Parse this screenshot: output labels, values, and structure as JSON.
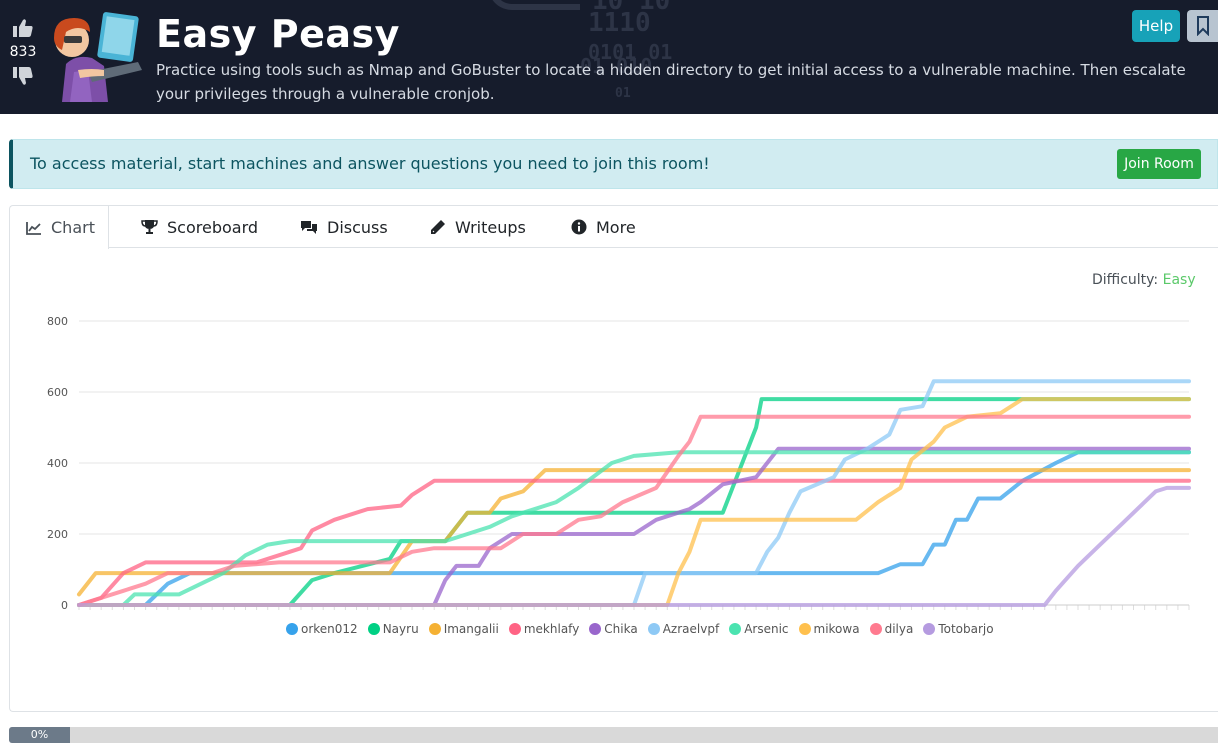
{
  "header": {
    "title": "Easy Peasy",
    "description": "Practice using tools such as Nmap and GoBuster to locate a hidden directory to get initial access to a vulnerable machine. Then escalate your privileges through a vulnerable cronjob.",
    "votes": "833",
    "help_label": "Help",
    "binary_text": [
      "10 10",
      "1110",
      "0101 01",
      "01 010",
      "01"
    ]
  },
  "alert": {
    "text": "To access material, start machines and answer questions you need to join this room!",
    "join_label": "Join Room"
  },
  "tabs": [
    {
      "label": "Chart",
      "icon": "line-chart-icon"
    },
    {
      "label": "Scoreboard",
      "icon": "trophy-icon"
    },
    {
      "label": "Discuss",
      "icon": "comments-icon"
    },
    {
      "label": "Writeups",
      "icon": "pencil-icon"
    },
    {
      "label": "More",
      "icon": "info-circle-icon"
    }
  ],
  "difficulty": {
    "label": "Difficulty:",
    "value": "Easy",
    "color": "#5bc96a"
  },
  "progress": {
    "value": 0,
    "label": "0%"
  },
  "chart_data": {
    "type": "line",
    "yticks": [
      0,
      200,
      400,
      600,
      800
    ],
    "ylim": [
      0,
      800
    ],
    "xlim": [
      0,
      100
    ],
    "grid": true,
    "legend_position": "bottom",
    "series": [
      {
        "name": "orken012",
        "color": "#36a2eb",
        "points": [
          [
            0,
            0
          ],
          [
            6,
            0
          ],
          [
            8,
            60
          ],
          [
            10,
            90
          ],
          [
            72,
            90
          ],
          [
            74,
            115
          ],
          [
            76,
            115
          ],
          [
            77,
            170
          ],
          [
            78,
            170
          ],
          [
            79,
            240
          ],
          [
            80,
            240
          ],
          [
            81,
            300
          ],
          [
            83,
            300
          ],
          [
            85,
            350
          ],
          [
            88,
            400
          ],
          [
            90,
            430
          ],
          [
            100,
            430
          ]
        ]
      },
      {
        "name": "Nayru",
        "color": "#00d084",
        "points": [
          [
            0,
            0
          ],
          [
            19,
            0
          ],
          [
            21,
            70
          ],
          [
            23,
            90
          ],
          [
            28,
            130
          ],
          [
            29,
            180
          ],
          [
            33,
            180
          ],
          [
            35,
            260
          ],
          [
            58,
            260
          ],
          [
            59,
            340
          ],
          [
            60,
            420
          ],
          [
            61,
            500
          ],
          [
            61.5,
            580
          ],
          [
            100,
            580
          ]
        ]
      },
      {
        "name": "Imangalii",
        "color": "#f5b133",
        "points": [
          [
            0,
            30
          ],
          [
            1.5,
            90
          ],
          [
            6,
            90
          ],
          [
            8,
            90
          ],
          [
            28,
            90
          ],
          [
            30,
            180
          ],
          [
            33,
            180
          ],
          [
            35,
            260
          ],
          [
            37,
            260
          ],
          [
            38,
            300
          ],
          [
            40,
            320
          ],
          [
            42,
            380
          ],
          [
            54,
            380
          ],
          [
            100,
            380
          ]
        ]
      },
      {
        "name": "mekhlafy",
        "color": "#ff6384",
        "points": [
          [
            0,
            0
          ],
          [
            2,
            20
          ],
          [
            4,
            90
          ],
          [
            6,
            120
          ],
          [
            16,
            120
          ],
          [
            18,
            140
          ],
          [
            20,
            160
          ],
          [
            21,
            210
          ],
          [
            23,
            240
          ],
          [
            26,
            270
          ],
          [
            29,
            280
          ],
          [
            30,
            310
          ],
          [
            32,
            350
          ],
          [
            100,
            350
          ]
        ]
      },
      {
        "name": "Chika",
        "color": "#9966cc",
        "points": [
          [
            0,
            0
          ],
          [
            32,
            0
          ],
          [
            33,
            70
          ],
          [
            34,
            110
          ],
          [
            36,
            110
          ],
          [
            37,
            160
          ],
          [
            39,
            200
          ],
          [
            50,
            200
          ],
          [
            52,
            240
          ],
          [
            55,
            270
          ],
          [
            56,
            290
          ],
          [
            58,
            340
          ],
          [
            61,
            360
          ],
          [
            63,
            440
          ],
          [
            68,
            440
          ],
          [
            100,
            440
          ]
        ]
      },
      {
        "name": "Azraelvpf",
        "color": "#8ec9f5",
        "points": [
          [
            0,
            0
          ],
          [
            50,
            0
          ],
          [
            51,
            90
          ],
          [
            61,
            90
          ],
          [
            62,
            150
          ],
          [
            63,
            190
          ],
          [
            64,
            260
          ],
          [
            65,
            320
          ],
          [
            68,
            360
          ],
          [
            69,
            410
          ],
          [
            71,
            440
          ],
          [
            73,
            480
          ],
          [
            74,
            550
          ],
          [
            76,
            560
          ],
          [
            77,
            630
          ],
          [
            100,
            630
          ]
        ]
      },
      {
        "name": "Arsenic",
        "color": "#4be3b0",
        "points": [
          [
            0,
            0
          ],
          [
            4,
            0
          ],
          [
            5,
            30
          ],
          [
            9,
            30
          ],
          [
            11,
            60
          ],
          [
            13,
            90
          ],
          [
            15,
            140
          ],
          [
            17,
            170
          ],
          [
            19,
            180
          ],
          [
            33,
            180
          ],
          [
            37,
            220
          ],
          [
            39,
            250
          ],
          [
            43,
            290
          ],
          [
            45,
            330
          ],
          [
            48,
            400
          ],
          [
            50,
            420
          ],
          [
            54,
            430
          ],
          [
            100,
            430
          ]
        ]
      },
      {
        "name": "mikowa",
        "color": "#ffc04d",
        "points": [
          [
            0,
            0
          ],
          [
            53,
            0
          ],
          [
            54,
            90
          ],
          [
            55,
            150
          ],
          [
            56,
            240
          ],
          [
            70,
            240
          ],
          [
            72,
            290
          ],
          [
            74,
            330
          ],
          [
            75,
            410
          ],
          [
            77,
            460
          ],
          [
            78,
            500
          ],
          [
            80,
            530
          ],
          [
            83,
            540
          ],
          [
            85,
            580
          ],
          [
            100,
            580
          ]
        ]
      },
      {
        "name": "dilya",
        "color": "#ff7a8f",
        "points": [
          [
            0,
            0
          ],
          [
            1,
            10
          ],
          [
            4,
            40
          ],
          [
            6,
            60
          ],
          [
            8,
            90
          ],
          [
            12,
            90
          ],
          [
            14,
            110
          ],
          [
            18,
            120
          ],
          [
            28,
            120
          ],
          [
            30,
            150
          ],
          [
            32,
            160
          ],
          [
            38,
            160
          ],
          [
            40,
            200
          ],
          [
            43,
            200
          ],
          [
            45,
            240
          ],
          [
            47,
            250
          ],
          [
            49,
            290
          ],
          [
            52,
            330
          ],
          [
            54,
            420
          ],
          [
            55,
            460
          ],
          [
            56,
            530
          ],
          [
            100,
            530
          ]
        ]
      },
      {
        "name": "Totobarjo",
        "color": "#b59be0",
        "points": [
          [
            0,
            0
          ],
          [
            87,
            0
          ],
          [
            88,
            40
          ],
          [
            90,
            110
          ],
          [
            92,
            170
          ],
          [
            94,
            230
          ],
          [
            96,
            290
          ],
          [
            97,
            320
          ],
          [
            98,
            330
          ],
          [
            100,
            330
          ]
        ]
      }
    ]
  }
}
